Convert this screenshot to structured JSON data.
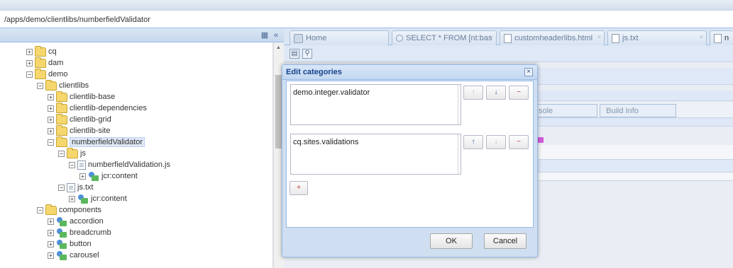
{
  "path_bar": {
    "text": "/apps/demo/clientlibs/numberfieldValidator"
  },
  "tree_header": {
    "icon_a": "folder-grid-icon",
    "icon_b": "collapse-left-icon"
  },
  "tree": [
    {
      "label": "cq",
      "toggle": "+"
    },
    {
      "label": "dam",
      "toggle": "+"
    },
    {
      "label": "demo",
      "toggle": "−"
    },
    {
      "label": "clientlibs",
      "toggle": "−"
    },
    {
      "label": "clientlib-base",
      "toggle": "+"
    },
    {
      "label": "clientlib-dependencies",
      "toggle": "+"
    },
    {
      "label": "clientlib-grid",
      "toggle": "+"
    },
    {
      "label": "clientlib-site",
      "toggle": "+"
    },
    {
      "label": "numberfieldValidator",
      "toggle": "−"
    },
    {
      "label": "js",
      "toggle": "−"
    },
    {
      "label": "numberfieldValidation.js",
      "toggle": "−"
    },
    {
      "label": "jcr:content",
      "toggle": "+"
    },
    {
      "label": "js.txt",
      "toggle": "−"
    },
    {
      "label": "jcr:content",
      "toggle": "+"
    },
    {
      "label": "components",
      "toggle": "−"
    },
    {
      "label": "accordion",
      "toggle": "+"
    },
    {
      "label": "breadcrumb",
      "toggle": "+"
    },
    {
      "label": "button",
      "toggle": "+"
    },
    {
      "label": "carousel",
      "toggle": "+"
    }
  ],
  "tabs": [
    {
      "label": "Home"
    },
    {
      "label": "SELECT * FROM [nt:bas"
    },
    {
      "label": "customheaderlibs.html"
    },
    {
      "label": "js.txt"
    },
    {
      "label": "n"
    }
  ],
  "subtabs": [
    {
      "label": "sole"
    },
    {
      "label": "Build Info"
    }
  ],
  "dialog": {
    "title": "Edit categories",
    "categories": [
      "demo.integer.validator",
      "cq.sites.validations"
    ],
    "up_label": "↑",
    "down_label": "↓",
    "remove_label": "−",
    "add_label": "+",
    "ok_label": "OK",
    "cancel_label": "Cancel"
  }
}
